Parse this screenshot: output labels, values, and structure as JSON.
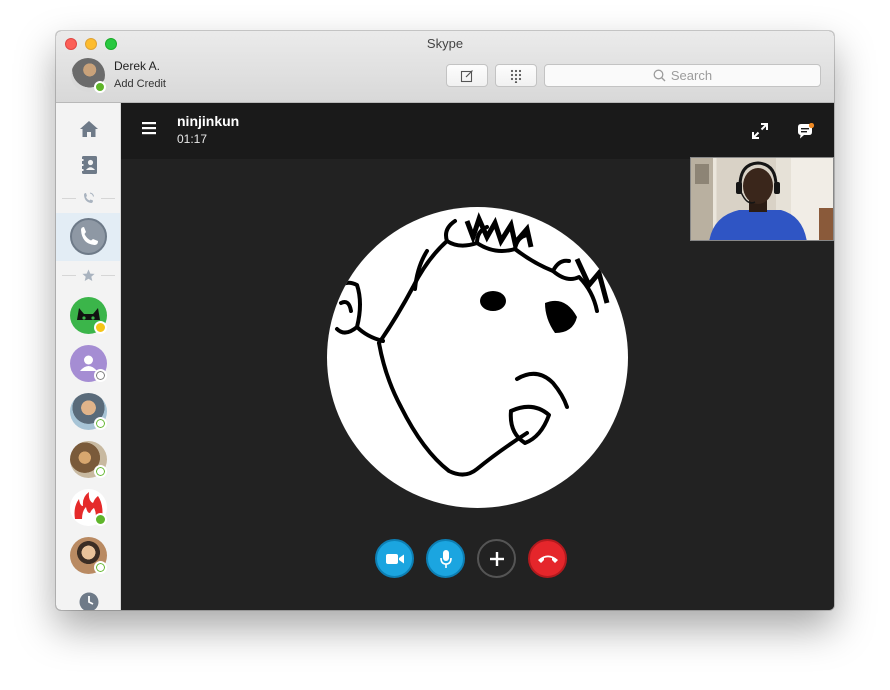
{
  "window": {
    "title": "Skype"
  },
  "profile": {
    "name": "Derek A.",
    "credit_label": "Add Credit",
    "presence_color": "#5fb52a"
  },
  "toolbar": {
    "compose_icon": "compose-icon",
    "dialpad_icon": "dialpad-icon"
  },
  "search": {
    "placeholder": "Search"
  },
  "sidebar": {
    "items": [
      {
        "icon": "home-icon"
      },
      {
        "icon": "contacts-icon"
      },
      {
        "icon": "recent-calls-icon"
      },
      {
        "icon": "active-call-icon"
      },
      {
        "icon": "favorites-star-icon"
      },
      {
        "icon": "history-clock-icon"
      }
    ],
    "contacts": [
      {
        "avatar": "green-cat",
        "presence": "away"
      },
      {
        "avatar": "default-purple",
        "presence": "unknown"
      },
      {
        "avatar": "photo",
        "presence": "offline"
      },
      {
        "avatar": "photo",
        "presence": "offline"
      },
      {
        "avatar": "red-flame",
        "presence": "online"
      },
      {
        "avatar": "photo",
        "presence": "offline"
      }
    ]
  },
  "call": {
    "callee_name": "ninjinkun",
    "duration": "01:17",
    "controls": [
      "video-toggle",
      "mic-toggle",
      "add-participant",
      "end-call"
    ],
    "accent_color": "#1ba5e0",
    "end_color": "#e5262b",
    "notification_color": "#f08a24"
  }
}
